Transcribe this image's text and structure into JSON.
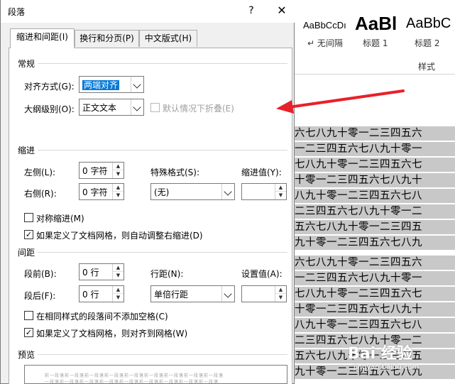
{
  "background": {
    "styles": [
      {
        "preview": "AaBbCcDı",
        "name": "↵ 无间隔"
      },
      {
        "preview": "AaBl",
        "name": "标题 1"
      },
      {
        "preview": "AaBbC",
        "name": "标题 2"
      }
    ],
    "styles_group_label": "样式",
    "doc_lines": [
      "五六七八九十零一二三四五六",
      "零一二三四五六七八九十零一",
      "六七八九十零一二三四五六七",
      "九十零一二三四五六七八九十",
      "七八九十零一二三四五六七八",
      "一二三四五六七八九十零一二",
      "四五六七八九十零一二三四五",
      "八九十零一二三四五六七八九",
      "五六七八九十零一二三四五六",
      "零一二三四五六七八九十零一",
      "六七八九十零一二三四五六七",
      "九十零一二三四五六七八九十",
      "七八九十零一二三四五六七八",
      "一二三四五六七八九十零一二",
      "四五六七八九十零一二三四五",
      "八九十零一二三四五六七八九"
    ],
    "watermark": "Bai 经验",
    "watermark_sub": "jingyan.baidu.com"
  },
  "dialog": {
    "title": "段落",
    "help": "?",
    "close": "✕",
    "tabs": [
      "缩进和间距(I)",
      "换行和分页(P)",
      "中文版式(H)"
    ],
    "general": {
      "title": "常规",
      "alignment_label": "对齐方式(G):",
      "alignment_value": "两端对齐",
      "outline_label": "大纲级别(O):",
      "outline_value": "正文文本",
      "collapse_label": "默认情况下折叠(E)"
    },
    "indent": {
      "title": "缩进",
      "left_label": "左侧(L):",
      "left_value": "0 字符",
      "right_label": "右侧(R):",
      "right_value": "0 字符",
      "special_label": "特殊格式(S):",
      "special_value": "(无)",
      "by_label": "缩进值(Y):",
      "by_value": "",
      "mirror_label": "对称缩进(M)",
      "auto_adjust_label": "如果定义了文档网格，则自动调整右缩进(D)"
    },
    "spacing": {
      "title": "间距",
      "before_label": "段前(B):",
      "before_value": "0 行",
      "after_label": "段后(F):",
      "after_value": "0 行",
      "line_label": "行距(N):",
      "line_value": "单倍行距",
      "at_label": "设置值(A):",
      "at_value": "",
      "no_space_label": "在相同样式的段落间不添加空格(C)",
      "snap_grid_label": "如果定义了文档网格，则对齐到网格(W)"
    },
    "preview": {
      "title": "预览",
      "line1": "前一段落前一段落前一段落前一段落前一段落前一段落前一段落前一段落前一段落",
      "line2": "一段落前一段落前一段落前一段落前一段落前一段落前一段落前一段落前一段落"
    }
  },
  "colors": {
    "accent": "#0078d7",
    "arrow": "#e8202a"
  }
}
